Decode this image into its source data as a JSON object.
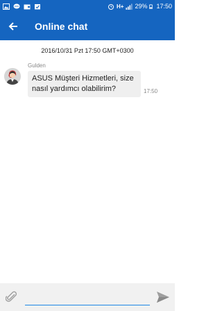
{
  "status_bar": {
    "left_icons": [
      "image-icon",
      "message-icon",
      "wallet-icon",
      "check-icon"
    ],
    "network_type": "H+",
    "battery": "29%",
    "time": "17:50"
  },
  "app_bar": {
    "title": "Online chat"
  },
  "chat": {
    "date_stamp": "2016/10/31 Pzt 17:50 GMT+0300",
    "messages": [
      {
        "sender": "Gulden",
        "text": "ASUS Müşteri Hizmetleri, size nasıl yardımcı olabilirim?",
        "time": "17:50"
      }
    ]
  },
  "input": {
    "value": "",
    "placeholder": ""
  },
  "colors": {
    "primary": "#1565c0",
    "accent": "#1e88e5",
    "bubble": "#efefef"
  }
}
